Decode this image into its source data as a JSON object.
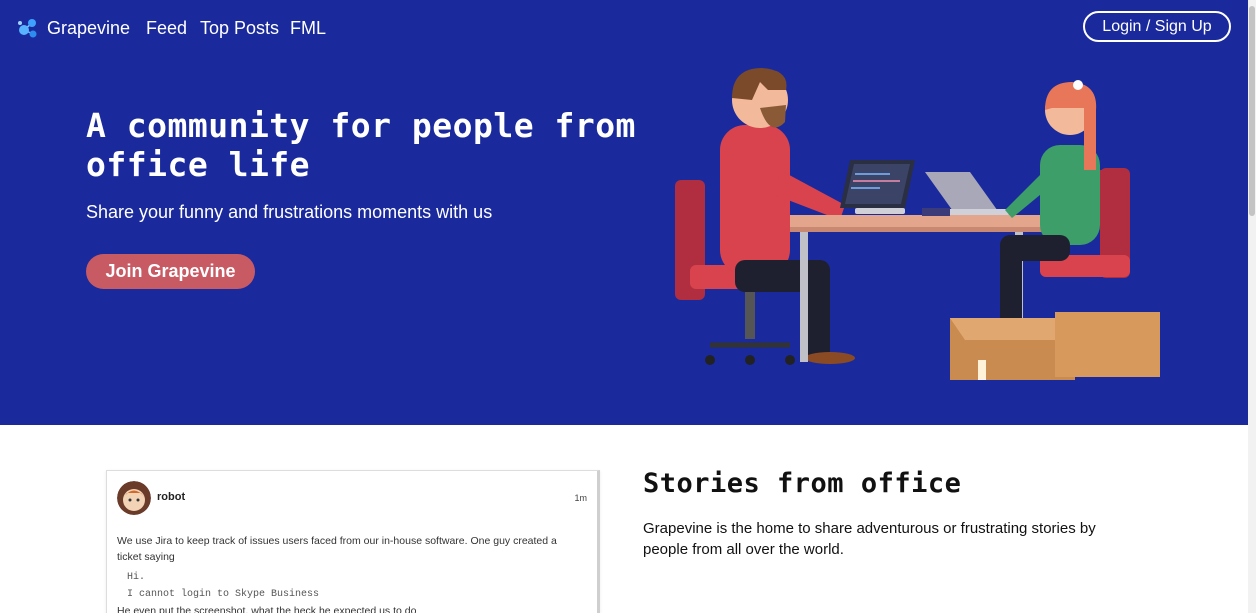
{
  "nav": {
    "brand": "Grapevine",
    "links": [
      "Feed",
      "Top Posts",
      "FML"
    ],
    "login_label": "Login / Sign Up"
  },
  "hero": {
    "title": "A community for people from office life",
    "subtitle": "Share your funny and frustrations moments with us",
    "cta_label": "Join Grapevine"
  },
  "post": {
    "username": "robot",
    "time": "1m",
    "text": "We use Jira to keep track of issues users faced from our in-house software. One guy created a ticket saying",
    "code": "Hi.\nI cannot login to Skype Business",
    "more": "He even put the screenshot, what the heck he expected us to do"
  },
  "stories": {
    "title": "Stories from office",
    "text": "Grapevine is the home to share adventurous or frustrating stories by people from all over the world."
  },
  "colors": {
    "hero_bg": "#1a2a9c",
    "cta_bg": "#c85a64",
    "text_light": "#ffffff"
  },
  "icons": {
    "brand_logo": "molecule-logo-icon"
  }
}
